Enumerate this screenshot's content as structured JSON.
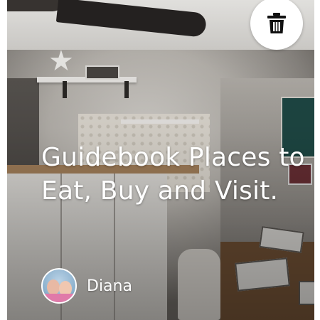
{
  "card": {
    "title": "Guidebook Places to Eat, Buy and Visit.",
    "author": {
      "name": "Diana",
      "avatar_icon": "user-photo"
    },
    "actions": {
      "delete_icon": "trash-icon"
    }
  },
  "colors": {
    "overlay_text": "#ffffff",
    "button_bg": "#ffffff",
    "icon": "#111111"
  }
}
